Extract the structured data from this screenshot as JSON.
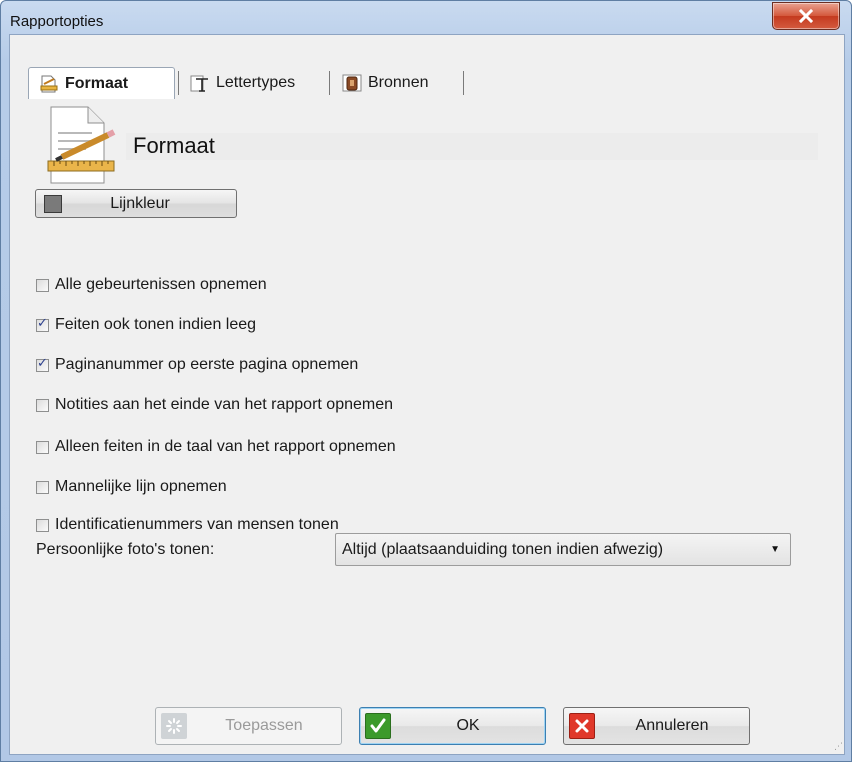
{
  "window": {
    "title": "Rapportopties"
  },
  "tabs": [
    {
      "label": "Formaat",
      "icon": "format-icon",
      "active": true
    },
    {
      "label": "Lettertypes",
      "icon": "font-icon",
      "active": false
    },
    {
      "label": "Bronnen",
      "icon": "sources-icon",
      "active": false
    }
  ],
  "section": {
    "title": "Formaat",
    "icon": "document-pencil-icon"
  },
  "line_color_button": {
    "label": "Lijnkleur",
    "swatch_color": "#7a7a7a"
  },
  "options": [
    {
      "label": "Alle gebeurtenissen opnemen",
      "checked": false
    },
    {
      "label": "Feiten ook tonen indien leeg",
      "checked": true
    },
    {
      "label": "Paginanummer op eerste pagina opnemen",
      "checked": true
    },
    {
      "label": "Notities aan het einde van het rapport opnemen",
      "checked": false
    },
    {
      "label": "Alleen feiten in de taal van het rapport opnemen",
      "checked": false
    },
    {
      "label": "Mannelijke lijn opnemen",
      "checked": false
    },
    {
      "label": "Identificatienummers van mensen tonen",
      "checked": false
    }
  ],
  "photos": {
    "label": "Persoonlijke foto's tonen:",
    "selected": "Altijd (plaatsaanduiding tonen indien afwezig)"
  },
  "footer": {
    "apply_label": "Toepassen",
    "ok_label": "OK",
    "cancel_label": "Annuleren"
  },
  "colors": {
    "titlebar": "#b6cce8",
    "close_button": "#c43a1f",
    "ok_icon": "#3c9a2b",
    "cancel_icon": "#e0382a"
  }
}
